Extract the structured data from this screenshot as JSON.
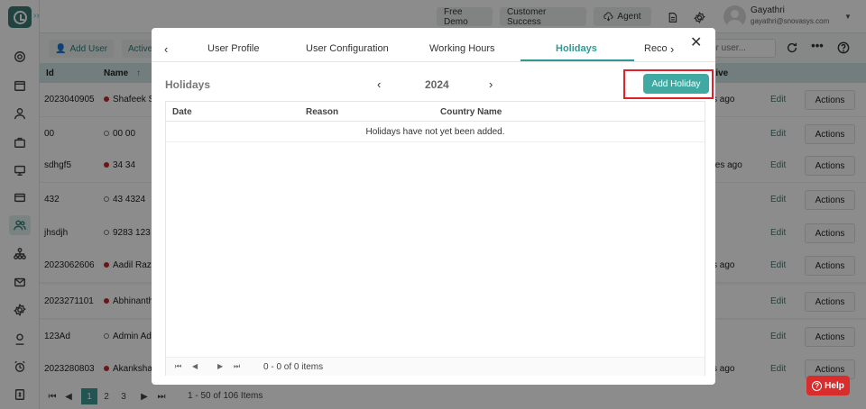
{
  "topbar": {
    "free_demo": "Free Demo",
    "customer_success": "Customer Success",
    "agent": "Agent",
    "user_name": "Gayathri",
    "user_email": "gayathri@snovasys.com"
  },
  "toolbar": {
    "add_user": "Add User",
    "active": "Active",
    "search_placeholder": "or user..."
  },
  "table": {
    "headers": {
      "id": "Id",
      "name": "Name",
      "active": "tive"
    },
    "rows": [
      {
        "id": "2023040905",
        "name": "Shafeek S",
        "status": "red",
        "active": "s ago",
        "edit": "Edit",
        "actions": "Actions"
      },
      {
        "id": "00",
        "name": "00 00",
        "status": "hollow",
        "active": "",
        "edit": "Edit",
        "actions": "Actions"
      },
      {
        "id": "sdhgf5",
        "name": "34 34",
        "status": "red",
        "active": "tes ago",
        "edit": "Edit",
        "actions": "Actions"
      },
      {
        "id": "432",
        "name": "43 4324",
        "status": "hollow",
        "active": "",
        "edit": "Edit",
        "actions": "Actions"
      },
      {
        "id": "jhsdjh",
        "name": "9283 123",
        "status": "hollow",
        "active": "",
        "edit": "Edit",
        "actions": "Actions"
      },
      {
        "id": "2023062606",
        "name": "Aadil Raza",
        "status": "red",
        "active": "s ago",
        "edit": "Edit",
        "actions": "Actions"
      },
      {
        "id": "2023271101",
        "name": "Abhinanth",
        "status": "red",
        "active": "",
        "edit": "Edit",
        "actions": "Actions"
      },
      {
        "id": "123Ad",
        "name": "Admin Ad",
        "status": "hollow",
        "active": "",
        "edit": "Edit",
        "actions": "Actions"
      },
      {
        "id": "2023280803",
        "name": "Akanksha",
        "status": "red",
        "active": "s ago",
        "edit": "Edit",
        "actions": "Actions"
      }
    ]
  },
  "pager": {
    "pages": [
      "1",
      "2",
      "3"
    ],
    "info": "1 - 50 of 106 Items"
  },
  "modal": {
    "tabs": [
      "User Profile",
      "User Configuration",
      "Working Hours",
      "Holidays",
      "Reco"
    ],
    "active_tab": "Holidays",
    "section_title": "Holidays",
    "year": "2024",
    "add_holiday": "Add Holiday",
    "grid": {
      "headers": [
        "Date",
        "Reason",
        "Country Name"
      ],
      "empty_message": "Holidays have not yet been added.",
      "footer_info": "0 - 0 of 0 items"
    }
  },
  "help": {
    "label": "Help"
  },
  "colors": {
    "accent": "#3fa9a2",
    "highlight": "#e1202b",
    "help": "#d92c2c"
  }
}
